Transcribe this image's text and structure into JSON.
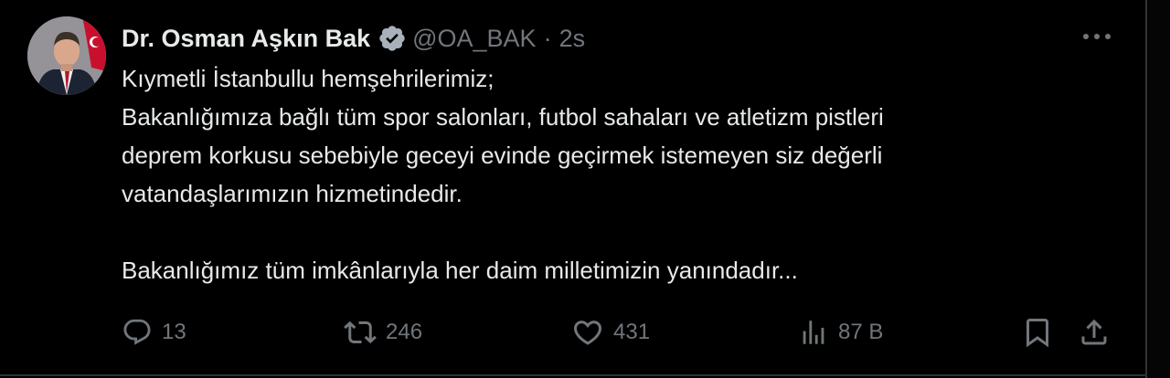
{
  "tweet": {
    "display_name": "Dr. Osman Aşkın Bak",
    "handle": "@OA_BAK",
    "separator": "·",
    "time": "2s",
    "lines": [
      "Kıymetli İstanbullu hemşehrilerimiz;",
      "Bakanlığımıza bağlı tüm spor salonları, futbol sahaları ve atletizm pistleri",
      "deprem korkusu sebebiyle geceyi evinde geçirmek istemeyen siz değerli",
      "vatandaşlarımızın hizmetindedir."
    ],
    "closing_line": "Bakanlığımız tüm imkânlarıyla her daim milletimizin yanındadır...",
    "actions": {
      "replies": "13",
      "reposts": "246",
      "likes": "431",
      "views": "87 B"
    }
  },
  "icons": {
    "verified": "verified-badge-icon",
    "more": "more-icon",
    "reply": "reply-icon",
    "repost": "repost-icon",
    "like": "heart-icon",
    "views": "views-icon",
    "bookmark": "bookmark-icon",
    "share": "share-icon"
  },
  "colors": {
    "background": "#000000",
    "text": "#e7e9ea",
    "muted": "#71767b",
    "verified": "#a9b2bb"
  }
}
